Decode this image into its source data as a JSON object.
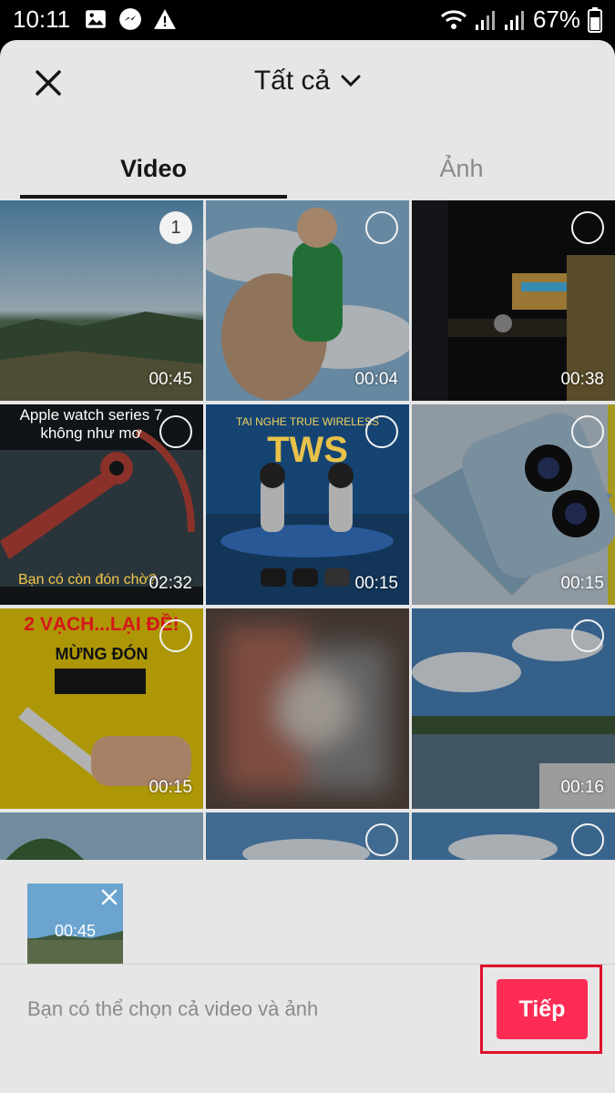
{
  "status_bar": {
    "time": "10:11",
    "battery": "67%"
  },
  "header": {
    "title": "Tất cả"
  },
  "tabs": [
    {
      "label": "Video"
    },
    {
      "label": "Ảnh"
    }
  ],
  "grid": {
    "items": [
      {
        "duration": "00:45",
        "selected_index": "1"
      },
      {
        "duration": "00:04"
      },
      {
        "duration": "00:38"
      },
      {
        "duration": "02:32",
        "caption_top": "Apple watch series 7 không như mơ",
        "caption_bottom": "Bạn có còn đón chờ?"
      },
      {
        "duration": "00:15",
        "caption_top": "TAI NGHE TRUE WIRELESS",
        "caption_big": "TWS"
      },
      {
        "duration": "00:15"
      },
      {
        "duration": "00:15",
        "caption_top": "2 VẠCH...LẠI ĐỀ!",
        "caption_mid": "MỪNG ĐÓN"
      },
      {
        "duration": ""
      },
      {
        "duration": "00:16"
      },
      {
        "duration": ""
      },
      {
        "duration": ""
      },
      {
        "duration": ""
      }
    ]
  },
  "selected_strip": {
    "items": [
      {
        "duration": "00:45"
      }
    ]
  },
  "footer": {
    "hint": "Bạn có thể chọn cả video và ảnh",
    "next_label": "Tiếp"
  },
  "colors": {
    "accent": "#fe2c55",
    "highlight_box": "#e0102a"
  }
}
